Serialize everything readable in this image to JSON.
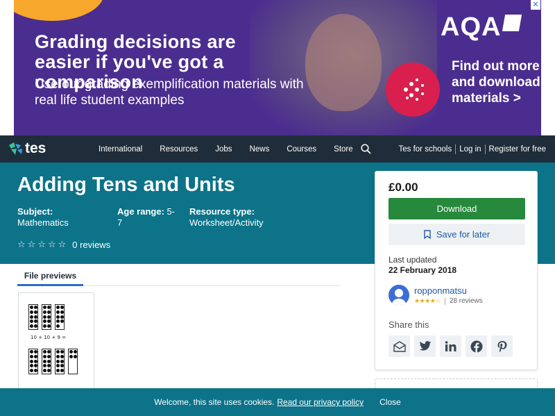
{
  "ad": {
    "headline": "Grading decisions are easier if you've got a comparison",
    "subtext": "Use our grading exemplification materials with real life student examples",
    "brand": "AQA",
    "cta": "Find out more and download materials >",
    "close_glyph": "✕",
    "colors": {
      "background": "#4b2d8f",
      "circle": "#d81f4e",
      "accent": "#f6a72c"
    }
  },
  "nav": {
    "logo": "tes",
    "links": [
      "International",
      "Resources",
      "Jobs",
      "News",
      "Courses",
      "Store"
    ],
    "right_links": [
      "Tes for schools",
      "Log in",
      "Register for free"
    ]
  },
  "resource": {
    "title": "Adding Tens and Units",
    "subject_label": "Subject:",
    "subject": "Mathematics",
    "age_label": "Age range:",
    "age": "5-7",
    "type_label": "Resource type:",
    "type": "Worksheet/Activity",
    "rating_stars": 0,
    "reviews": "0 reviews"
  },
  "tabs": {
    "file_previews": "File previews"
  },
  "preview": {
    "sum_text": "10 + 10 + 9 ="
  },
  "sidebar": {
    "price": "£0.00",
    "download": "Download",
    "save": "Save for later",
    "last_updated_label": "Last updated",
    "last_updated": "22 February 2018",
    "author": "ropponmatsu",
    "author_stars": 4,
    "author_reviews": "28 reviews",
    "share_label": "Share this",
    "share_icons": [
      "email-icon",
      "twitter-icon",
      "linkedin-icon",
      "facebook-icon",
      "pinterest-icon"
    ]
  },
  "cookie": {
    "text": "Welcome, this site uses cookies.",
    "link": "Read our privacy policy",
    "close": "Close"
  },
  "colors": {
    "hero": "#0c7389",
    "nav": "#1f2d3a",
    "download": "#27893c",
    "link": "#1e5aa8"
  }
}
